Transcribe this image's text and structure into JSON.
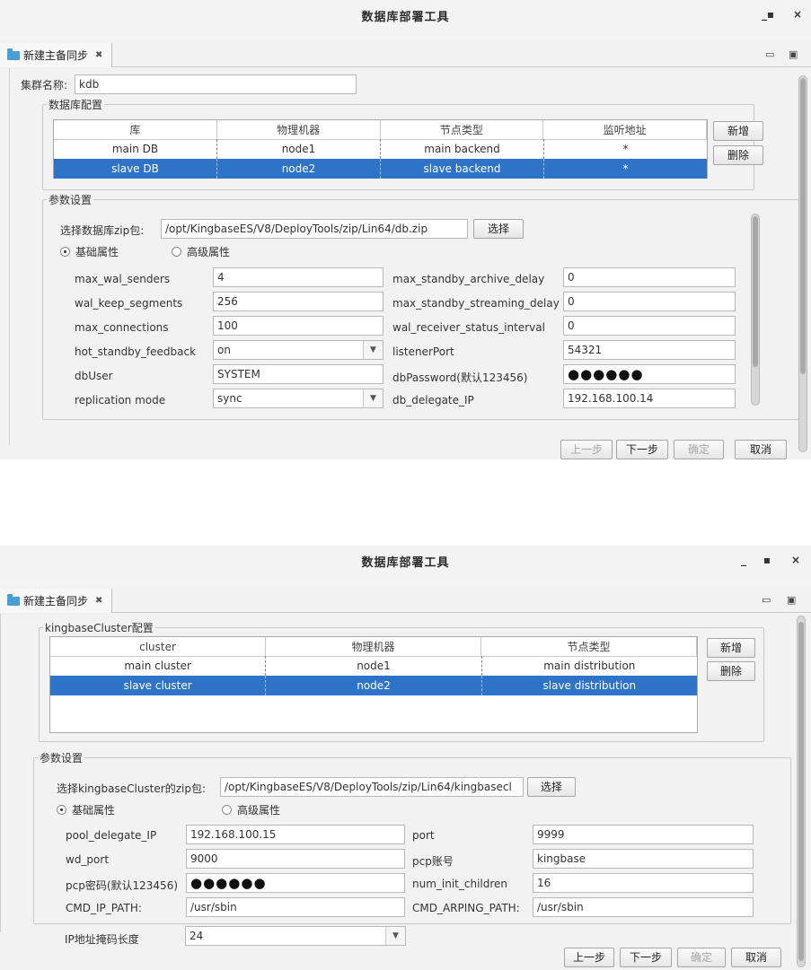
{
  "app_title": "数据库部署工具",
  "tab_label": "新建主备同步",
  "screen1": {
    "cluster_name_label": "集群名称:",
    "cluster_name_value": "kdb",
    "db_config_title": "数据库配置",
    "table_headers": [
      "库",
      "物理机器",
      "节点类型",
      "监听地址"
    ],
    "rows": [
      [
        "main DB",
        "node1",
        "main backend",
        "*"
      ],
      [
        "slave DB",
        "node2",
        "slave backend",
        "*"
      ]
    ],
    "add_button": "新增",
    "delete_button": "删除",
    "params_title": "参数设置",
    "zip_label": "选择数据库zip包:",
    "zip_path": "/opt/KingbaseES/V8/DeployTools/zip/Lin64/db.zip",
    "choose_button": "选择",
    "radio_basic": "基础属性",
    "radio_advanced": "高级属性",
    "left_params": [
      {
        "label": "max_wal_senders",
        "value": "4",
        "combo": false
      },
      {
        "label": "wal_keep_segments",
        "value": "256",
        "combo": false
      },
      {
        "label": "max_connections",
        "value": "100",
        "combo": false
      },
      {
        "label": "hot_standby_feedback",
        "value": "on",
        "combo": true
      },
      {
        "label": "dbUser",
        "value": "SYSTEM",
        "combo": false
      },
      {
        "label": "replication mode",
        "value": "sync",
        "combo": true
      }
    ],
    "right_params": [
      {
        "label": "max_standby_archive_delay",
        "value": "0"
      },
      {
        "label": "max_standby_streaming_delay",
        "value": "0"
      },
      {
        "label": "wal_receiver_status_interval",
        "value": "0"
      },
      {
        "label": "listenerPort",
        "value": "54321"
      },
      {
        "label": "dbPassword(默认123456)",
        "value": "●●●●●●"
      },
      {
        "label": "db_delegate_IP",
        "value": "192.168.100.14"
      }
    ],
    "prev_button": "上一步",
    "next_button": "下一步",
    "confirm_button": "确定",
    "cancel_button": "取消"
  },
  "screen2": {
    "cluster_config_title": "kingbaseCluster配置",
    "table_headers": [
      "cluster",
      "物理机器",
      "节点类型"
    ],
    "rows": [
      [
        "main cluster",
        "node1",
        "main distribution"
      ],
      [
        "slave cluster",
        "node2",
        "slave distribution"
      ]
    ],
    "add_button": "新增",
    "delete_button": "删除",
    "params_title": "参数设置",
    "zip_label": "选择kingbaseCluster的zip包:",
    "zip_path": "/opt/KingbaseES/V8/DeployTools/zip/Lin64/kingbasecl",
    "choose_button": "选择",
    "radio_basic": "基础属性",
    "radio_advanced": "高级属性",
    "left_params": [
      {
        "label": "pool_delegate_IP",
        "value": "192.168.100.15"
      },
      {
        "label": "wd_port",
        "value": "9000"
      },
      {
        "label": "pcp密码(默认123456)",
        "value": "●●●●●●"
      },
      {
        "label": "CMD_IP_PATH:",
        "value": "/usr/sbin"
      },
      {
        "label": "IP地址掩码长度",
        "value": "24"
      }
    ],
    "right_params": [
      {
        "label": "port",
        "value": "9999"
      },
      {
        "label": "pcp账号",
        "value": "kingbase"
      },
      {
        "label": "num_init_children",
        "value": "16"
      },
      {
        "label": "CMD_ARPING_PATH:",
        "value": "/usr/sbin"
      }
    ],
    "prev_button": "上一步",
    "next_button": "下一步",
    "confirm_button": "确定",
    "cancel_button": "取消"
  }
}
